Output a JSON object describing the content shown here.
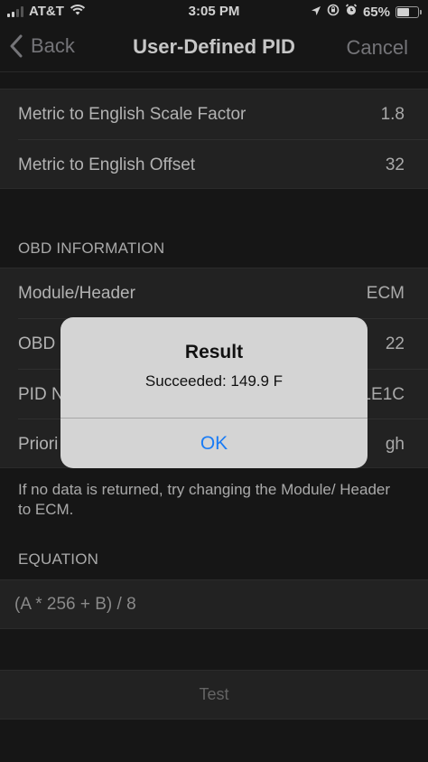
{
  "status_bar": {
    "carrier": "AT&T",
    "time": "3:05 PM",
    "battery": "65%",
    "battery_level": 0.65,
    "icons": [
      "signal-icon",
      "wifi-icon",
      "location-icon",
      "screen-lock-icon",
      "alarm-icon",
      "battery-icon"
    ]
  },
  "nav": {
    "back_label": "Back",
    "title": "User-Defined PID",
    "cancel_label": "Cancel"
  },
  "conversion": {
    "rows": [
      {
        "label": "Metric to English Scale Factor",
        "value": "1.8"
      },
      {
        "label": "Metric to English Offset",
        "value": "32"
      }
    ]
  },
  "obd": {
    "header": "OBD INFORMATION",
    "rows": [
      {
        "label": "Module/Header",
        "value": "ECM"
      },
      {
        "label": "OBD",
        "value": "22"
      },
      {
        "label": "PID N",
        "value": "1E1C"
      },
      {
        "label": "Priori",
        "value": "gh"
      }
    ],
    "note": "If no data is returned, try changing the Module/ Header to ECM."
  },
  "equation": {
    "header": "EQUATION",
    "value": "(A * 256 + B) / 8"
  },
  "test_label": "Test",
  "alert": {
    "title": "Result",
    "message": "Succeeded: 149.9 F",
    "ok_label": "OK"
  },
  "colors": {
    "background": "#1c1c1c",
    "cell": "#2a2a2a",
    "accent": "#1a7cf5",
    "alert_bg": "#d4d4d4"
  }
}
